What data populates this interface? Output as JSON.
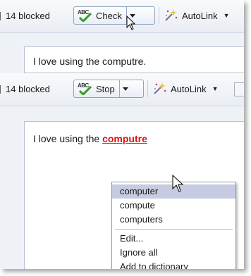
{
  "top": {
    "blocked_text": "14 blocked",
    "spell_button_label": "Check",
    "autolink_label": "AutoLink",
    "editor_text": "I love using the computre."
  },
  "bottom": {
    "blocked_text": "14 blocked",
    "spell_button_label": "Stop",
    "autolink_label": "AutoLink",
    "editor_prefix": "I love using the ",
    "misspelled_word": "computre"
  },
  "icons": {
    "spellcheck": "abc-check-icon",
    "autolink": "magic-wand-icon",
    "dropdown": "chevron-down-icon"
  },
  "colors": {
    "misspelled": "#e01010",
    "highlight": "#c5cbe0",
    "check_green": "#3a9a2a"
  },
  "context_menu": {
    "suggestions": [
      "computer",
      "compute",
      "computers"
    ],
    "actions": [
      "Edit...",
      "Ignore all",
      "Add to dictionary"
    ]
  }
}
